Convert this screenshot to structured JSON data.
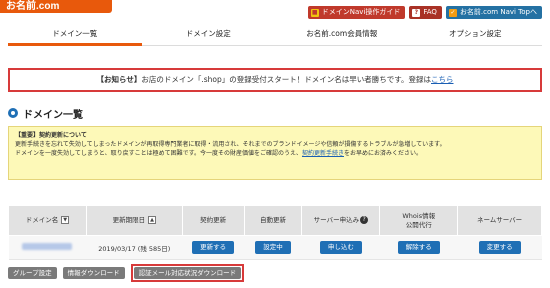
{
  "header": {
    "logo_text": "お名前.com",
    "links": [
      {
        "label": "ドメインNavi操作ガイド",
        "icon": "book-icon"
      },
      {
        "label": "FAQ",
        "icon": "question-icon"
      },
      {
        "label": "お名前.com Navi Topへ",
        "icon": "check-icon"
      }
    ]
  },
  "tabs": [
    {
      "label": "ドメイン一覧",
      "active": true
    },
    {
      "label": "ドメイン設定"
    },
    {
      "label": "お名前.com会員情報"
    },
    {
      "label": "オプション設定"
    }
  ],
  "notice": {
    "prefix": "【お知らせ】",
    "text": "お店のドメイン「.shop」の登録受付スタート！ドメイン名は早い者勝ちです。登録は",
    "link": "こちら"
  },
  "section_title": "ドメイン一覧",
  "important": {
    "title": "【重要】契約更新について",
    "line1": "更新手続きを忘れて失効してしまったドメインが再取得専門業者に取得・流用され、それまでのブランドイメージや信頼が損傷するトラブルが急増しています。",
    "line2": "ドメインを一度失効してしまうと、取り戻すことは極めて困難です。今一度その財産価値をご確認のうえ、",
    "link": "契約更新手続き",
    "line2_suffix": "をお早めにお済みください。"
  },
  "table": {
    "headers": {
      "domain": "ドメイン名",
      "expiry": "更新期限日",
      "renew": "契約更新",
      "auto": "自動更新",
      "server": "サーバー申込み",
      "whois_line1": "Whois情報",
      "whois_line2": "公開代行",
      "nameserver": "ネームサーバー"
    },
    "row": {
      "expiry": "2019/03/17 (残 585日)",
      "renew_btn": "更新する",
      "auto_btn": "設定中",
      "server_btn": "申し込む",
      "whois_btn": "解除する",
      "ns_btn": "変更する"
    }
  },
  "bottom_buttons": {
    "group": "グループ設定",
    "download": "情報ダウンロード",
    "auth_mail": "認証メール対応状況ダウンロード"
  }
}
